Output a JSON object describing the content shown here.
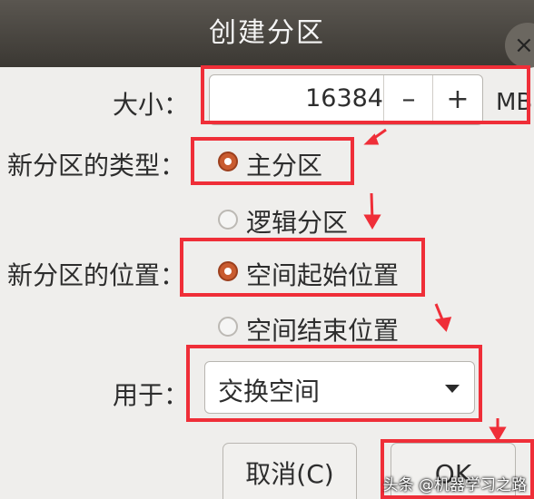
{
  "dialog": {
    "title": "创建分区",
    "close_icon": "×"
  },
  "size": {
    "label": "大小：",
    "value": "16384",
    "minus": "–",
    "plus": "+",
    "unit": "MB"
  },
  "partition_type": {
    "label": "新分区的类型：",
    "options": [
      {
        "label": "主分区",
        "selected": true
      },
      {
        "label": "逻辑分区",
        "selected": false
      }
    ]
  },
  "partition_location": {
    "label": "新分区的位置：",
    "options": [
      {
        "label": "空间起始位置",
        "selected": true
      },
      {
        "label": "空间结束位置",
        "selected": false
      }
    ]
  },
  "use_as": {
    "label": "用于：",
    "value": "交换空间"
  },
  "buttons": {
    "cancel": "取消(C)",
    "ok": "OK"
  },
  "watermark": "头条 @机器学习之路",
  "colors": {
    "annotation_red": "#ef2e38",
    "radio_selected": "#c95c30",
    "titlebar": "#4a4740"
  }
}
